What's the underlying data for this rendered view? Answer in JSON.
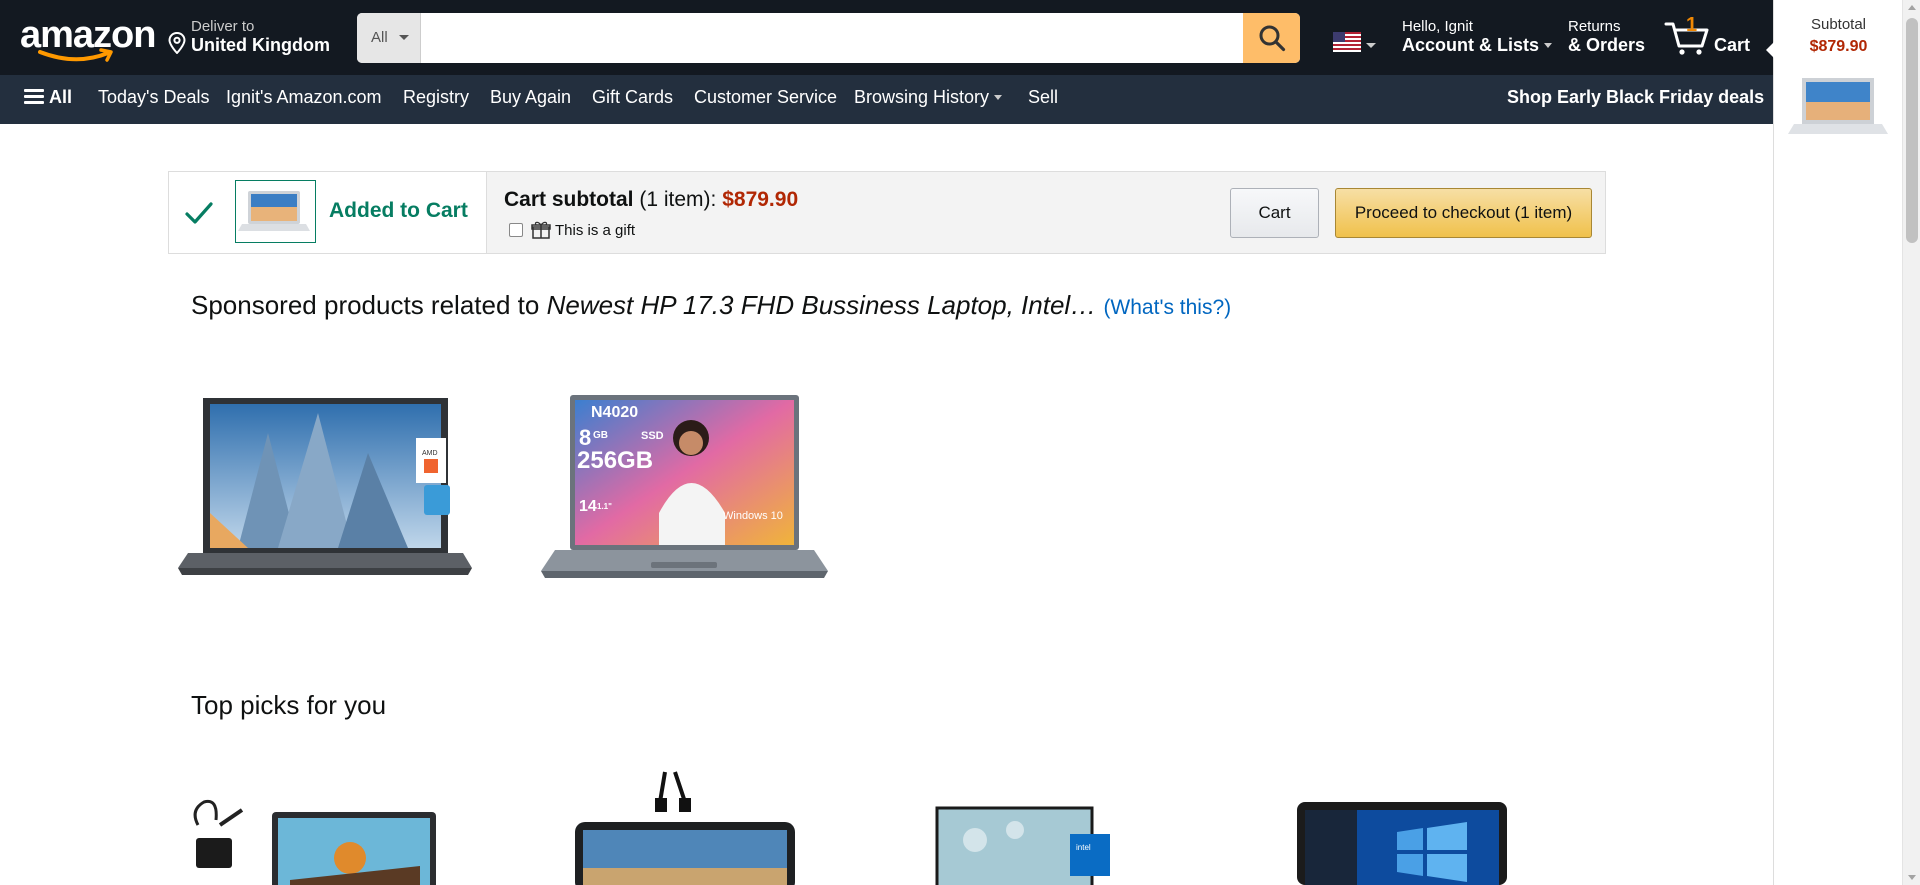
{
  "header": {
    "logo": "amazon",
    "deliver_to_label": "Deliver to",
    "deliver_to_location": "United Kingdom",
    "search_department": "All",
    "search_placeholder": "",
    "language_flag": "us-flag-icon",
    "account_greeting": "Hello, Ignit",
    "account_label": "Account & Lists",
    "returns_line1": "Returns",
    "returns_line2": "& Orders",
    "cart_count": "1",
    "cart_label": "Cart"
  },
  "nav": {
    "all_label": "All",
    "items": [
      "Today's Deals",
      "Ignit's Amazon.com",
      "Registry",
      "Buy Again",
      "Gift Cards",
      "Customer Service",
      "Browsing History",
      "Sell"
    ],
    "promo": "Shop Early Black Friday deals"
  },
  "added_to_cart": {
    "status": "Added to Cart",
    "subtotal_label": "Cart subtotal",
    "subtotal_items": "(1 item):",
    "subtotal_price": "$879.90",
    "gift_label": "This is a gift",
    "cart_button": "Cart",
    "checkout_button": "Proceed to checkout (1 item)"
  },
  "sponsored": {
    "prefix": "Sponsored products related to",
    "query": "Newest HP 17.3 FHD Bussiness Laptop, Intel…",
    "whats_this": "(What's this?)",
    "product2_overlay": {
      "cpu": "N4020",
      "ram": "8",
      "ram_unit": "GB",
      "ssd": "SSD",
      "storage": "256GB",
      "size": "14",
      "size_unit": "1.1\"",
      "os": "Windows 10"
    }
  },
  "top_picks": {
    "title": "Top picks for you"
  },
  "sidebar": {
    "subtotal_label": "Subtotal",
    "subtotal_amount": "$879.90"
  },
  "colors": {
    "nav_top": "#131921",
    "nav_main": "#232f3e",
    "search_button": "#febd69",
    "price": "#b12704",
    "success": "#067d62",
    "link": "#0066c0",
    "cart_count": "#f08804"
  }
}
